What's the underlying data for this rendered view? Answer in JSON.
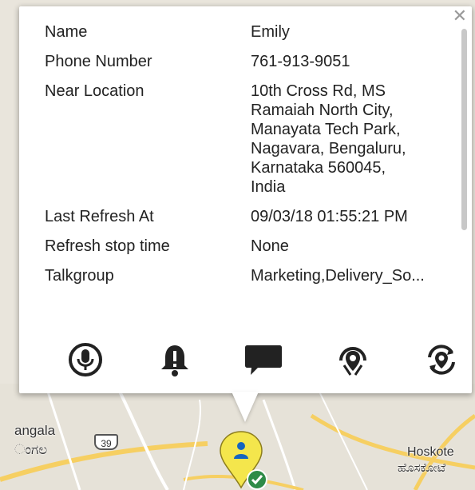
{
  "map": {
    "labels": {
      "left_1": "angala",
      "left_2": "ಂಗಲ",
      "right_1": "Hoskote",
      "right_2": "ಹೊಸಕೋಟೆ"
    },
    "route_shield": "39"
  },
  "popup": {
    "close_icon": "close-icon",
    "rows": [
      {
        "label": "Name",
        "value": "Emily"
      },
      {
        "label": "Phone Number",
        "value": "761-913-9051"
      },
      {
        "label": "Near Location",
        "value": "10th Cross Rd, MS\nRamaiah North City,\nManayata Tech Park,\nNagavara, Bengaluru,\nKarnataka 560045,\nIndia"
      },
      {
        "label": "Last Refresh At",
        "value": "09/03/18 01:55:21 PM"
      },
      {
        "label": "Refresh stop time",
        "value": "None"
      },
      {
        "label": "Talkgroup",
        "value": "Marketing,Delivery_So..."
      }
    ],
    "actions": [
      {
        "name": "ptt-call-button",
        "icon": "microphone-icon"
      },
      {
        "name": "alert-button",
        "icon": "bell-icon"
      },
      {
        "name": "message-button",
        "icon": "chat-bubble-icon"
      },
      {
        "name": "locate-button",
        "icon": "location-pin-icon"
      },
      {
        "name": "track-button",
        "icon": "location-refresh-icon"
      }
    ]
  },
  "colors": {
    "marker_fill": "#f4e64c",
    "marker_person": "#1565c0",
    "status_check": "#2e8b47"
  }
}
